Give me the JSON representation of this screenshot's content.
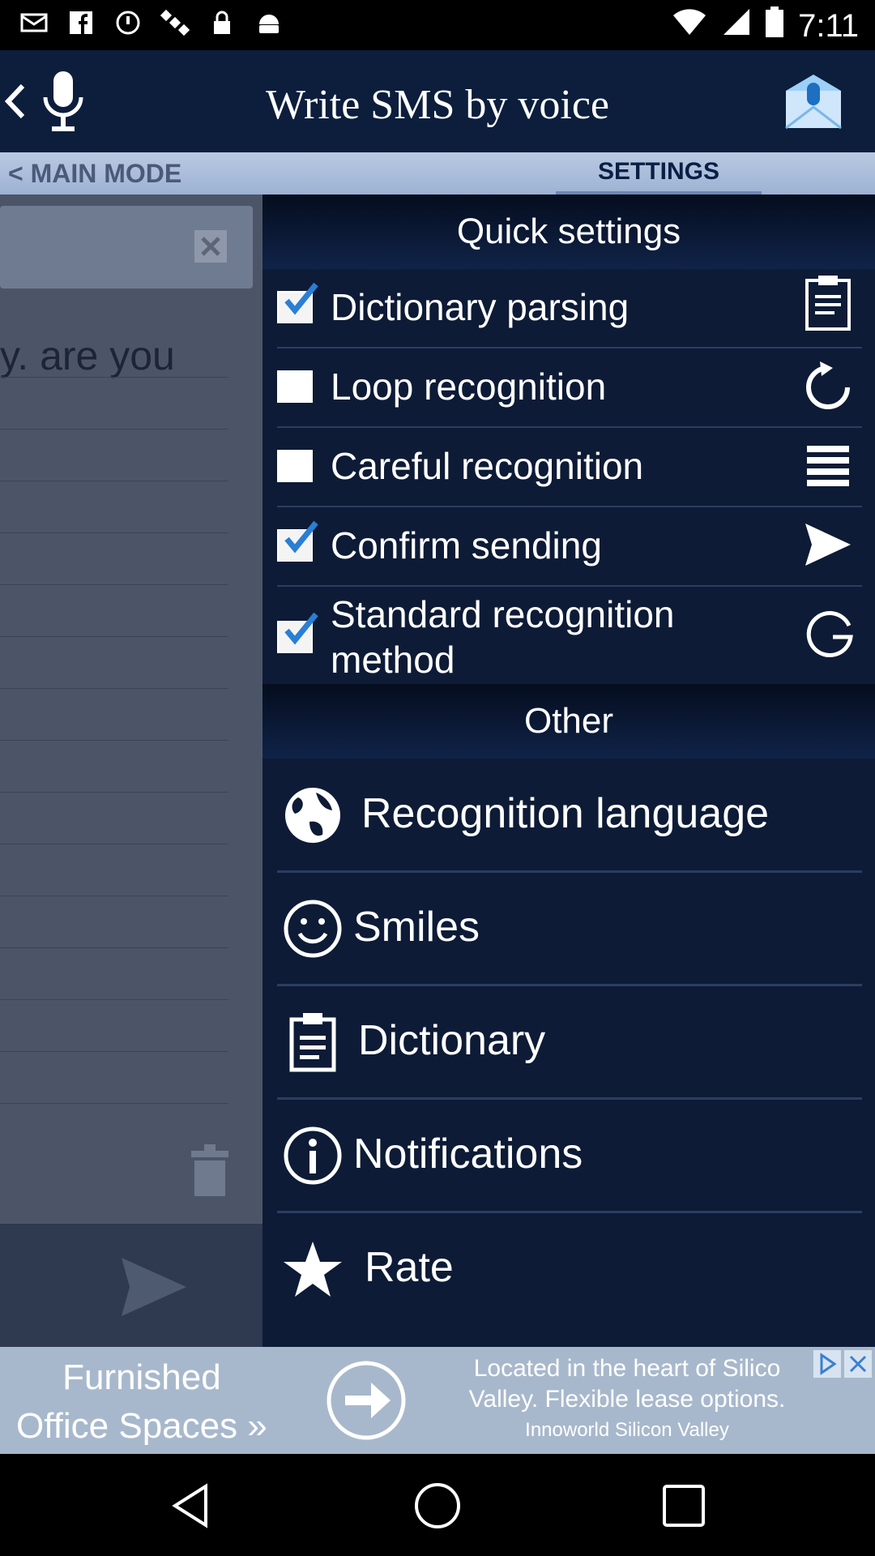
{
  "status_bar": {
    "time": "7:11",
    "icons": [
      "mail-icon",
      "facebook-icon",
      "sync-icon",
      "satellite-icon",
      "lock-icon",
      "android-icon"
    ],
    "right_icons": [
      "wifi-icon",
      "signal-icon",
      "battery-icon"
    ]
  },
  "appbar": {
    "title": "Write SMS by voice"
  },
  "mode_tabs": {
    "main_mode": "< MAIN MODE",
    "settings": "SETTINGS"
  },
  "editor": {
    "text": "y. are you"
  },
  "quick_settings": {
    "header": "Quick settings",
    "items": [
      {
        "label": "Dictionary parsing",
        "checked": true,
        "icon": "clipboard-icon"
      },
      {
        "label": "Loop recognition",
        "checked": false,
        "icon": "refresh-icon"
      },
      {
        "label": "Careful recognition",
        "checked": false,
        "icon": "list-icon"
      },
      {
        "label": "Confirm sending",
        "checked": true,
        "icon": "send-icon"
      },
      {
        "label": "Standard recognition method",
        "checked": true,
        "icon": "google-g-icon"
      }
    ]
  },
  "other": {
    "header": "Other",
    "items": [
      {
        "label": "Recognition language",
        "icon": "globe-icon"
      },
      {
        "label": "Smiles",
        "icon": "smiley-icon"
      },
      {
        "label": "Dictionary",
        "icon": "clipboard-icon"
      },
      {
        "label": "Notifications",
        "icon": "info-icon"
      },
      {
        "label": "Rate",
        "icon": "star-icon"
      }
    ]
  },
  "ad": {
    "left_line1": "Furnished",
    "left_line2": "Office Spaces »",
    "right_line1": "Located in the heart of Silico",
    "right_line2": "Valley. Flexible lease options.",
    "advertiser": "Innoworld Silicon Valley"
  },
  "colors": {
    "panel_bg": "#0d1b36",
    "appbar_bg": "#0c1e3c",
    "check_blue": "#2a7fd4"
  }
}
